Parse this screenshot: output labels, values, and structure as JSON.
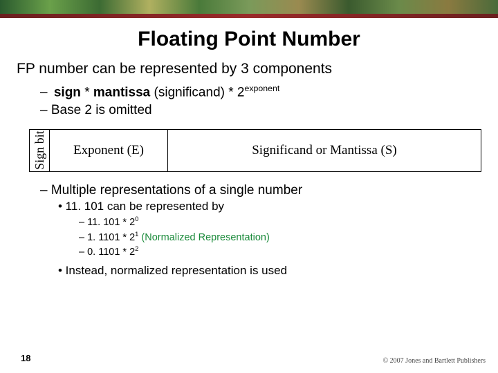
{
  "title": "Floating Point Number",
  "main_line": "FP number can be represented by 3 components",
  "formula": {
    "prefix": "– ",
    "sign": "sign",
    "star1": " * ",
    "mantissa": "mantissa",
    "paren": " (significand) * 2",
    "exp": "exponent"
  },
  "base_omitted": "– Base 2 is omitted",
  "diagram": {
    "sign": "Sign bit",
    "exp": "Exponent (E)",
    "sig": "Significand or Mantissa (S)"
  },
  "multi_rep": "– Multiple representations of a single number",
  "example_intro": "• 11. 101 can be represented by",
  "examples": [
    {
      "pre": "– 11. 101 * 2",
      "sup": "0",
      "post": ""
    },
    {
      "pre": "– 1. 1101 * 2",
      "sup": "1",
      "post": "  (Normalized Representation)"
    },
    {
      "pre": "– 0. 1101 * 2",
      "sup": "2",
      "post": ""
    }
  ],
  "instead": "• Instead, normalized representation is used",
  "page_number": "18",
  "copyright": "© 2007 Jones and Bartlett Publishers"
}
